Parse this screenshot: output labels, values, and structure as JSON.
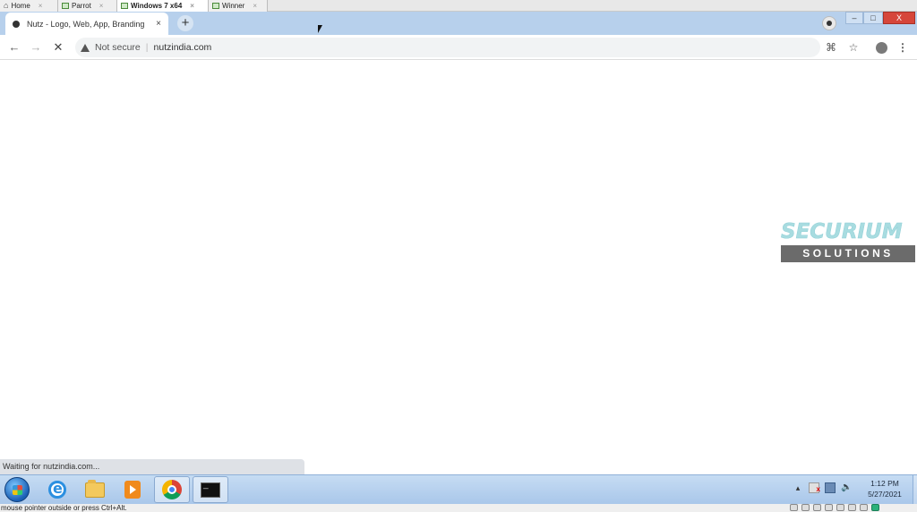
{
  "vm_tabs": [
    {
      "label": "Home",
      "icon": "home-icon"
    },
    {
      "label": "Parrot",
      "icon": "vm-icon"
    },
    {
      "label": "Windows 7 x64",
      "icon": "vm-icon",
      "active": true
    },
    {
      "label": "Winner",
      "icon": "vm-icon"
    }
  ],
  "browser": {
    "tab_title": "Nutz - Logo, Web, App, Branding",
    "new_tab_label": "+",
    "close_tab_label": "×",
    "address": {
      "security_label": "Not secure",
      "url": "nutzindia.com"
    }
  },
  "watermark": {
    "top_text": "SECURIUM",
    "bottom_text": "SOLUTIONS",
    "accent_color": "#a8dce0"
  },
  "status_bubble": "Waiting for nutzindia.com...",
  "window_controls": {
    "minimize": "–",
    "maximize": "□",
    "close": "X"
  },
  "taskbar": {
    "apps": [
      "start-orb",
      "internet-explorer",
      "windows-explorer",
      "media-player",
      "google-chrome",
      "command-prompt"
    ],
    "clock": {
      "time": "1:12 PM",
      "date": "5/27/2021"
    }
  },
  "host_status": "mouse pointer outside or press Ctrl+Alt."
}
